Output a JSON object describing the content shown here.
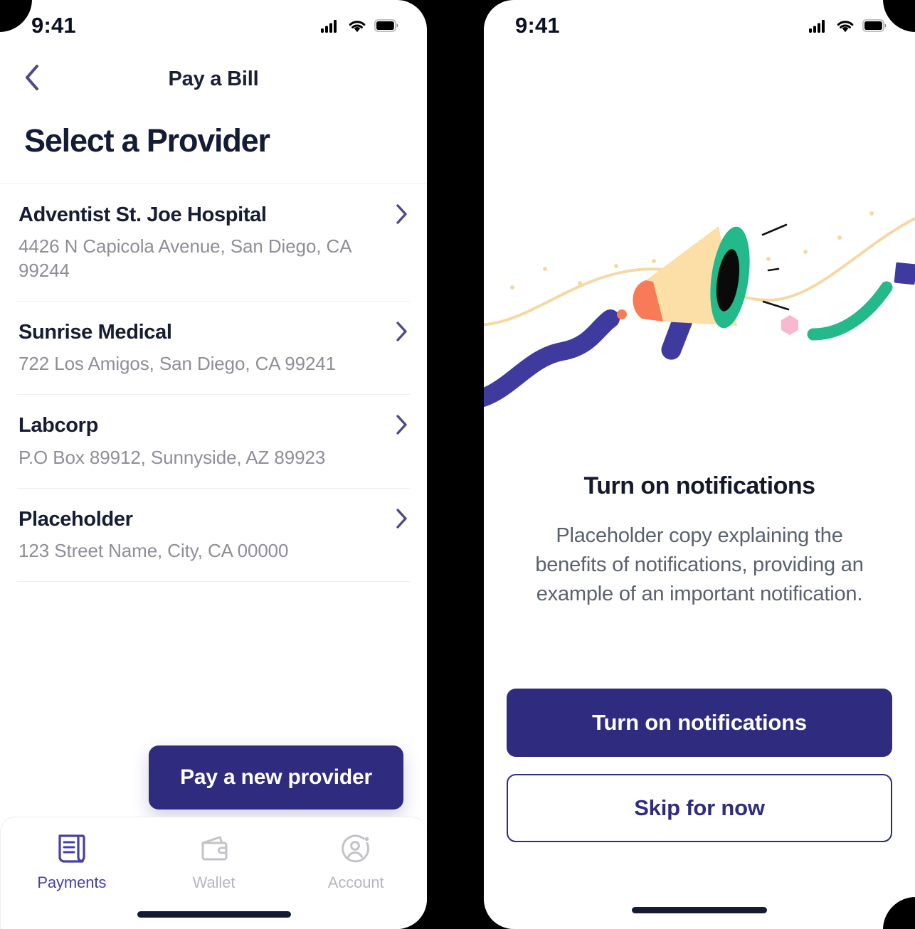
{
  "left_screen": {
    "status_bar": {
      "time": "9:41",
      "icons": [
        "cellular-signal-icon",
        "wifi-icon",
        "battery-icon"
      ]
    },
    "nav": {
      "back_icon": "chevron-left-icon",
      "title": "Pay a Bill"
    },
    "page_title": "Select a Provider",
    "providers": [
      {
        "name": "Adventist St. Joe Hospital",
        "address": "4426 N Capicola Avenue, San Diego, CA 99244"
      },
      {
        "name": "Sunrise Medical",
        "address": "722 Los Amigos, San Diego, CA 99241"
      },
      {
        "name": "Labcorp",
        "address": "P.O Box 89912, Sunnyside, AZ 89923"
      },
      {
        "name": "Placeholder",
        "address": "123 Street Name, City, CA 00000"
      }
    ],
    "cta": {
      "label": "Pay a new provider"
    },
    "tab_bar": [
      {
        "label": "Payments",
        "icon": "bill-document-icon",
        "active": true
      },
      {
        "label": "Wallet",
        "icon": "wallet-icon",
        "active": false
      },
      {
        "label": "Account",
        "icon": "user-circle-icon",
        "active": false
      }
    ]
  },
  "right_screen": {
    "status_bar": {
      "time": "9:41",
      "icons": [
        "cellular-signal-icon",
        "wifi-icon",
        "battery-icon"
      ]
    },
    "illustration": "megaphone-announcement-illustration",
    "title": "Turn on notifications",
    "description": "Placeholder copy explaining the benefits of notifications, providing an example of an important notification.",
    "primary_button": "Turn on notifications",
    "secondary_button": "Skip for now"
  },
  "colors": {
    "brand_indigo": "#2f2b7e",
    "accent_violet": "#4440a8",
    "text_dark": "#141b34",
    "text_muted": "#8e8e98",
    "divider": "#eeeef2",
    "illus_cream": "#fbdfa6",
    "illus_green": "#23b98a",
    "illus_orange": "#f87a56",
    "illus_blue": "#3f3a9e",
    "illus_pink": "#f9b8cd"
  }
}
